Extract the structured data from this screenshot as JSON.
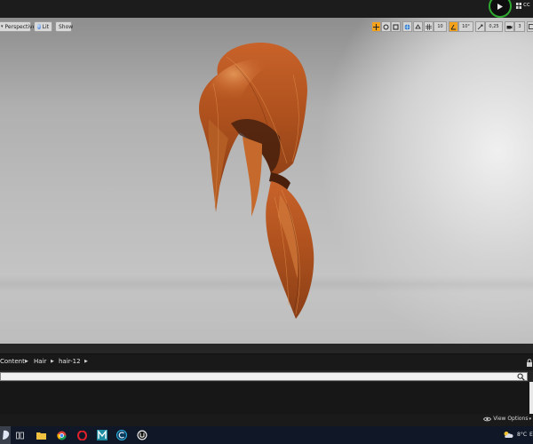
{
  "topbar": {
    "status_icon": "play-icon",
    "cut_text": "cc"
  },
  "viewport": {
    "perspective_label": "Perspective",
    "lit_label": "Lit",
    "show_label": "Show",
    "grid_snap_value": "10",
    "rotation_snap_value": "10°",
    "scale_snap_value": "0,25",
    "camera_speed_value": "3"
  },
  "content_browser": {
    "breadcrumbs": [
      "Content",
      "Hair",
      "hair-12"
    ],
    "search_placeholder": "",
    "view_options_label": "View Options"
  },
  "taskbar": {
    "apps": [
      "start-icon",
      "task-view-icon",
      "file-explorer-icon",
      "chrome-icon",
      "opera-icon",
      "maya-icon",
      "c-app-icon",
      "unreal-engine-icon"
    ],
    "temperature": "8°C",
    "overflow_text": "E"
  },
  "colors": {
    "accent_orange": "#f4a11c",
    "ring_green": "#2fa82f",
    "hair_color": "#b8561e"
  }
}
